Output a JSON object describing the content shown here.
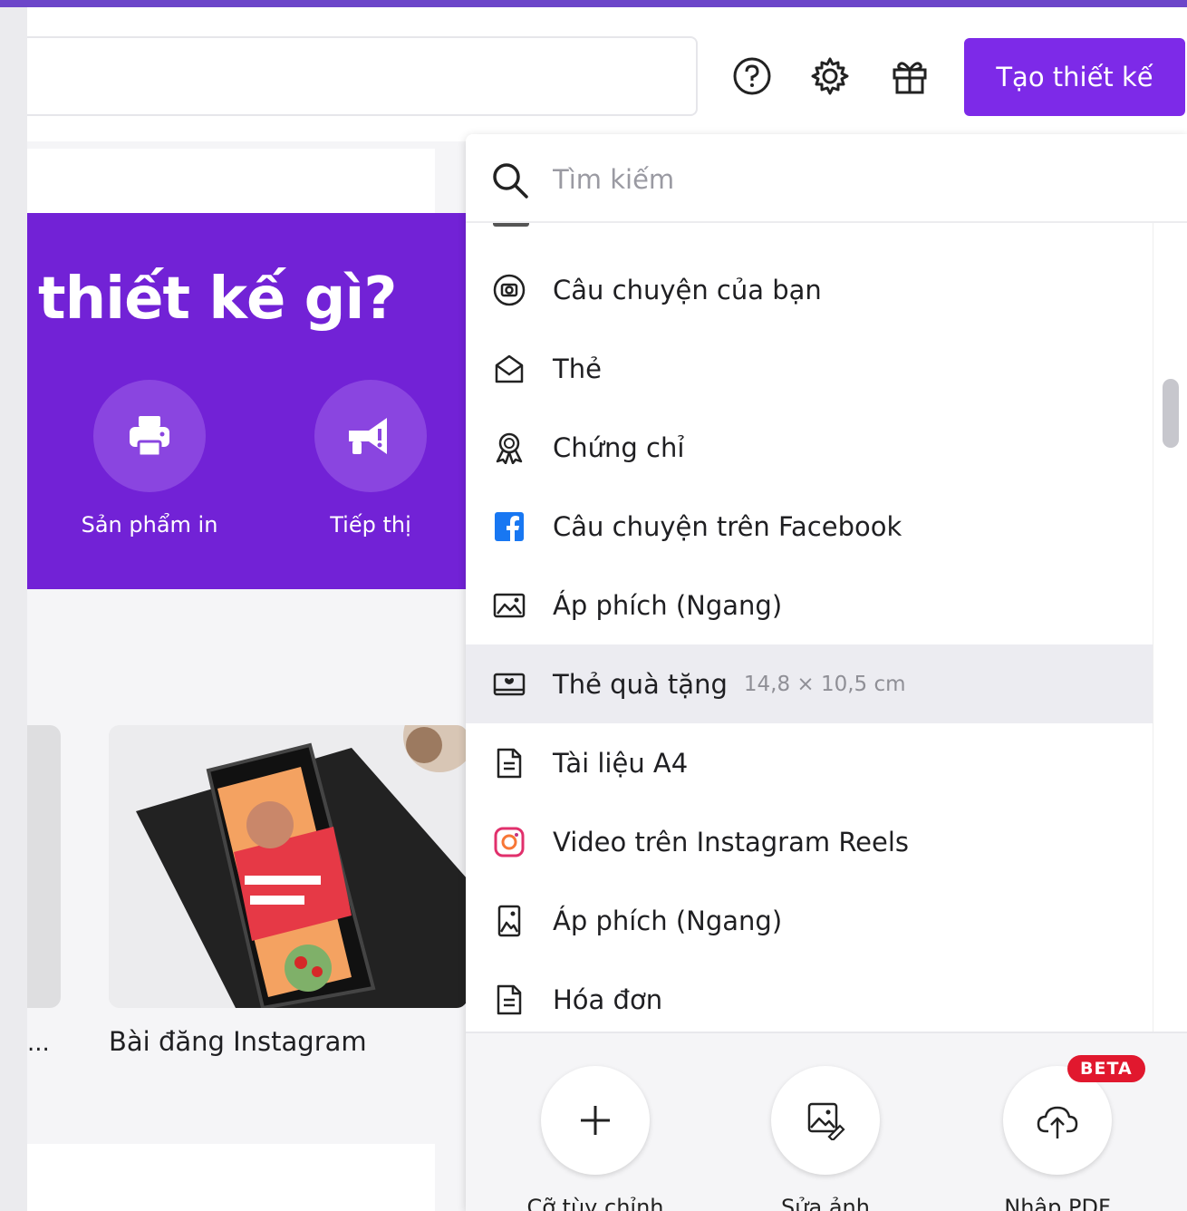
{
  "header": {
    "create_button": "Tạo thiết kế",
    "icons": [
      "help-icon",
      "gear-icon",
      "gift-icon"
    ]
  },
  "hero": {
    "title": "thiết kế gì?",
    "categories": [
      {
        "label": "Sản phẩm in",
        "icon": "printer-icon"
      },
      {
        "label": "Tiếp thị",
        "icon": "megaphone-icon"
      }
    ]
  },
  "templates": {
    "truncated_label": "...",
    "main_label": "Bài đăng Instagram"
  },
  "dropdown": {
    "search_placeholder": "Tìm kiếm",
    "items": [
      {
        "label": "Câu chuyện của bạn",
        "icon": "camera-icon"
      },
      {
        "label": "Thẻ",
        "icon": "envelope-icon"
      },
      {
        "label": "Chứng chỉ",
        "icon": "award-icon"
      },
      {
        "label": "Câu chuyện trên Facebook",
        "icon": "facebook-icon"
      },
      {
        "label": "Áp phích (Ngang)",
        "icon": "image-landscape-icon"
      },
      {
        "label": "Thẻ quà tặng",
        "dimensions": "14,8 × 10,5 cm",
        "icon": "gift-card-icon",
        "highlighted": true
      },
      {
        "label": "Tài liệu A4",
        "icon": "document-icon"
      },
      {
        "label": "Video trên Instagram Reels",
        "icon": "instagram-icon"
      },
      {
        "label": "Áp phích (Ngang)",
        "icon": "image-portrait-icon"
      },
      {
        "label": "Hóa đơn",
        "icon": "invoice-icon"
      }
    ],
    "footer_actions": [
      {
        "label": "Cỡ tùy chỉnh",
        "icon": "plus-icon"
      },
      {
        "label": "Sửa ảnh",
        "icon": "edit-photo-icon"
      },
      {
        "label": "Nhập PDF",
        "icon": "cloud-upload-icon",
        "badge": "BETA"
      }
    ]
  },
  "colors": {
    "accent": "#7d2ae8",
    "hero_bg": "#7222d6",
    "badge": "#e1182e",
    "facebook": "#1877f2"
  }
}
